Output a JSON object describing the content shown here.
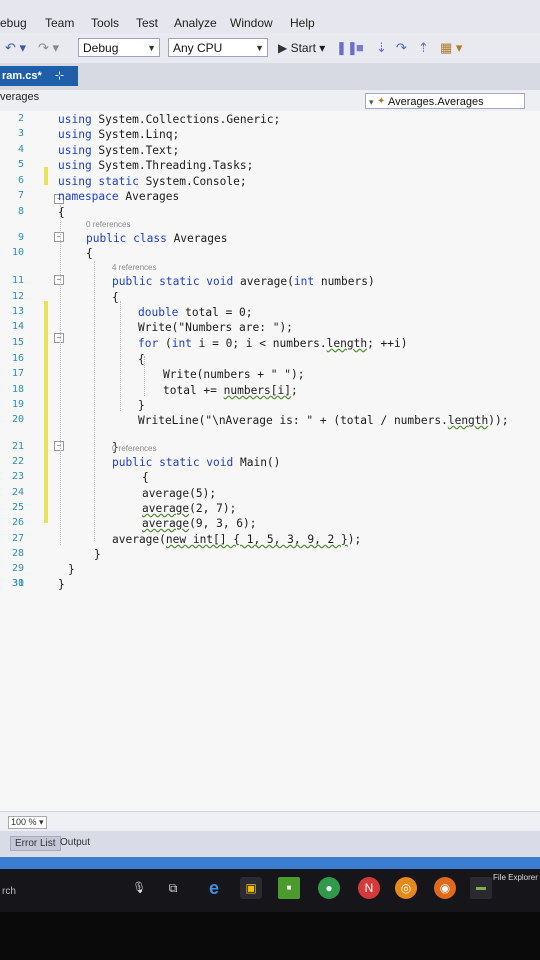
{
  "menu": [
    "ebug",
    "Team",
    "Tools",
    "Test",
    "Analyze",
    "Window",
    "Help"
  ],
  "toolbar": {
    "config": "Debug",
    "platform": "Any CPU",
    "start_label": "Start"
  },
  "tab": {
    "label": "ram.cs*",
    "pin": "⊹",
    "close": "✕"
  },
  "nav": {
    "left": "verages",
    "right": "Averages.Averages"
  },
  "code": {
    "lines": [
      {
        "n": "2",
        "segs": [
          [
            "kw",
            "using "
          ],
          [
            "",
            "System.Collections.Generic;"
          ]
        ]
      },
      {
        "n": "3",
        "segs": [
          [
            "kw",
            "using "
          ],
          [
            "",
            "System.Linq;"
          ]
        ]
      },
      {
        "n": "4",
        "segs": [
          [
            "kw",
            "using "
          ],
          [
            "",
            "System.Text;"
          ]
        ]
      },
      {
        "n": "5",
        "segs": [
          [
            "kw",
            "using "
          ],
          [
            "",
            "System.Threading.Tasks;"
          ]
        ]
      },
      {
        "n": "6",
        "segs": [
          [
            "kw",
            "using static "
          ],
          [
            "",
            "System.Console;"
          ]
        ]
      },
      {
        "n": "7",
        "segs": [
          [
            "kw",
            "namespace "
          ],
          [
            "",
            "Averages"
          ]
        ]
      },
      {
        "n": "8",
        "segs": [
          [
            "",
            "{"
          ]
        ]
      },
      {
        "n": "9",
        "ref": "0 references",
        "segs": [
          [
            "kw",
            "public class "
          ],
          [
            "",
            "Averages"
          ]
        ]
      },
      {
        "n": "10",
        "segs": [
          [
            "",
            "{"
          ]
        ]
      },
      {
        "n": "11",
        "ref": "4 references",
        "segs": [
          [
            "kw",
            "public static void "
          ],
          [
            "",
            "average("
          ],
          [
            "kw",
            "int "
          ],
          [
            "",
            "numbers)"
          ]
        ]
      },
      {
        "n": "12",
        "segs": [
          [
            "",
            "{"
          ]
        ]
      },
      {
        "n": "13",
        "segs": [
          [
            "kw",
            "double "
          ],
          [
            "",
            "total = 0;"
          ]
        ]
      },
      {
        "n": "14",
        "segs": [
          [
            "",
            "Write(\"Numbers are: \");"
          ]
        ]
      },
      {
        "n": "15",
        "segs": [
          [
            "kw",
            "for "
          ],
          [
            "",
            "("
          ],
          [
            "kw",
            "int "
          ],
          [
            "",
            "i = 0; i < numbers."
          ],
          [
            "sq",
            "length"
          ],
          [
            "",
            "; ++i)"
          ]
        ]
      },
      {
        "n": "16",
        "segs": [
          [
            "",
            "{"
          ]
        ]
      },
      {
        "n": "17",
        "segs": [
          [
            "",
            "Write(numbers + \" \");"
          ]
        ]
      },
      {
        "n": "18",
        "segs": [
          [
            "",
            "total += "
          ],
          [
            "sq",
            "numbers[i]"
          ],
          [
            "",
            ";"
          ]
        ]
      },
      {
        "n": "19",
        "segs": [
          [
            "",
            "}"
          ]
        ]
      },
      {
        "n": "20",
        "segs": [
          [
            "",
            "WriteLine(\"\\nAverage is: \" + (total / numbers."
          ],
          [
            "sq",
            "length"
          ],
          [
            "",
            "));"
          ]
        ]
      },
      {
        "n": "21",
        "segs": [
          [
            "",
            "}"
          ]
        ]
      },
      {
        "n": "22",
        "ref": "0 references",
        "segs": [
          [
            "kw",
            "public static void "
          ],
          [
            "",
            "Main()"
          ]
        ]
      },
      {
        "n": "23",
        "segs": [
          [
            "",
            "{"
          ]
        ]
      },
      {
        "n": "24",
        "segs": [
          [
            "",
            "average(5);"
          ]
        ]
      },
      {
        "n": "25",
        "segs": [
          [
            "sq",
            "average"
          ],
          [
            "",
            "(2, 7);"
          ]
        ]
      },
      {
        "n": "26",
        "segs": [
          [
            "sq",
            "average"
          ],
          [
            "",
            "(9, 3, 6);"
          ]
        ]
      },
      {
        "n": "27",
        "segs": [
          [
            "",
            "average("
          ],
          [
            "sq",
            "new int[] { 1, 5, 3, 9, 2 }"
          ],
          [
            "",
            ");"
          ]
        ]
      },
      {
        "n": "28",
        "segs": [
          [
            "",
            "}"
          ]
        ]
      },
      {
        "n": "29",
        "segs": [
          [
            "",
            "}"
          ]
        ]
      },
      {
        "n": "30",
        "segs": [
          [
            "",
            "}"
          ]
        ]
      },
      {
        "n": "31",
        "segs": []
      }
    ]
  },
  "zoom": "100 %",
  "output_tabs": [
    "Error List",
    "Output"
  ],
  "taskbar": {
    "search": "rch",
    "file_explorer": "File Explorer"
  }
}
